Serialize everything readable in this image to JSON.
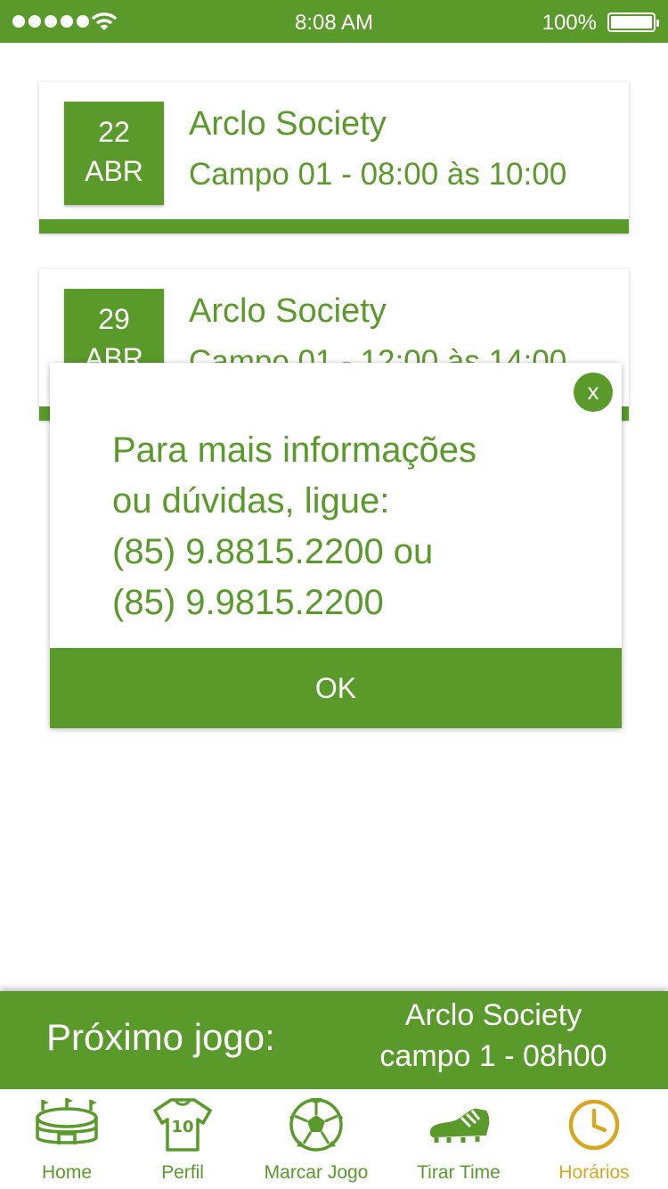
{
  "status_bar": {
    "time": "8:08 AM",
    "battery": "100%"
  },
  "bookings": [
    {
      "day": "22",
      "month": "ABR",
      "venue": "Arclo Society",
      "detail": "Campo 01 - 08:00 às 10:00"
    },
    {
      "day": "29",
      "month": "ABR",
      "venue": "Arclo Society",
      "detail": "Campo 01 - 12:00 às 14:00"
    }
  ],
  "modal": {
    "close": "x",
    "lines": [
      "Para mais informações",
      "ou dúvidas, ligue:",
      "(85) 9.8815.2200 ou",
      "(85) 9.9815.2200"
    ],
    "ok": "OK"
  },
  "next_game": {
    "label": "Próximo jogo:",
    "venue": "Arclo Society",
    "field": "campo 1 - 08h00"
  },
  "tabs": [
    {
      "label": "Home",
      "icon": "stadium-icon"
    },
    {
      "label": "Perfil",
      "icon": "jersey-icon"
    },
    {
      "label": "Marcar Jogo",
      "icon": "soccer-ball-icon"
    },
    {
      "label": "Tirar Time",
      "icon": "cleat-icon"
    },
    {
      "label": "Horários",
      "icon": "clock-icon",
      "active": true
    }
  ],
  "colors": {
    "primary": "#5a9a2b",
    "accent": "#d8a722"
  }
}
